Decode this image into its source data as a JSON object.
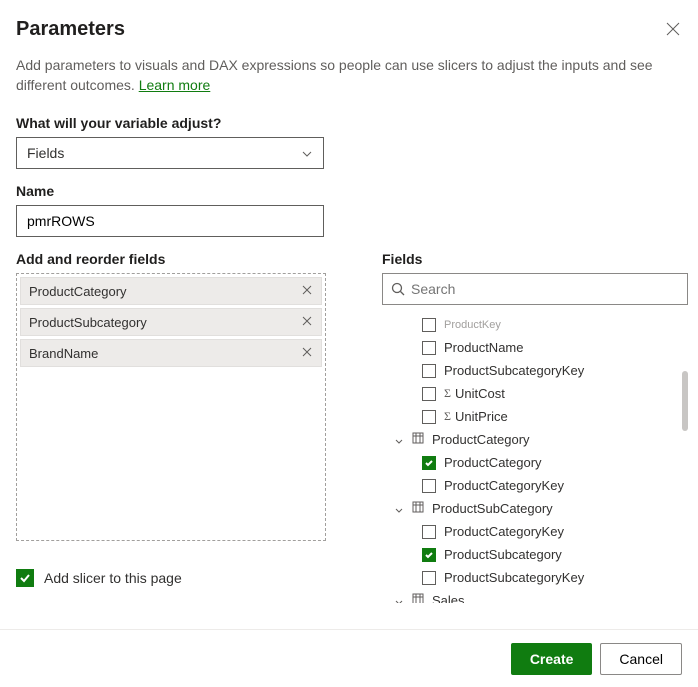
{
  "header": {
    "title": "Parameters",
    "description_before": "Add parameters to visuals and DAX expressions so people can use slicers to adjust the inputs and see different outcomes. ",
    "learn_more": "Learn more"
  },
  "form": {
    "adjust_label": "What will your variable adjust?",
    "adjust_value": "Fields",
    "name_label": "Name",
    "name_value": "pmrROWS",
    "reorder_label": "Add and reorder fields",
    "fields_label": "Fields",
    "search_placeholder": "Search",
    "slicer_label": "Add slicer to this page",
    "slicer_checked": true
  },
  "selected_fields": [
    {
      "label": "ProductCategory"
    },
    {
      "label": "ProductSubcategory"
    },
    {
      "label": "BrandName"
    }
  ],
  "tree": [
    {
      "type": "leaf",
      "label": "ProductKey",
      "checked": false,
      "faded": true
    },
    {
      "type": "leaf",
      "label": "ProductName",
      "checked": false
    },
    {
      "type": "leaf",
      "label": "ProductSubcategoryKey",
      "checked": false
    },
    {
      "type": "leaf",
      "label": "UnitCost",
      "checked": false,
      "sigma": true
    },
    {
      "type": "leaf",
      "label": "UnitPrice",
      "checked": false,
      "sigma": true
    },
    {
      "type": "group",
      "label": "ProductCategory"
    },
    {
      "type": "leaf",
      "label": "ProductCategory",
      "checked": true
    },
    {
      "type": "leaf",
      "label": "ProductCategoryKey",
      "checked": false
    },
    {
      "type": "group",
      "label": "ProductSubCategory"
    },
    {
      "type": "leaf",
      "label": "ProductCategoryKey",
      "checked": false
    },
    {
      "type": "leaf",
      "label": "ProductSubcategory",
      "checked": true
    },
    {
      "type": "leaf",
      "label": "ProductSubcategoryKey",
      "checked": false
    },
    {
      "type": "group",
      "label": "Sales"
    }
  ],
  "footer": {
    "create": "Create",
    "cancel": "Cancel"
  }
}
